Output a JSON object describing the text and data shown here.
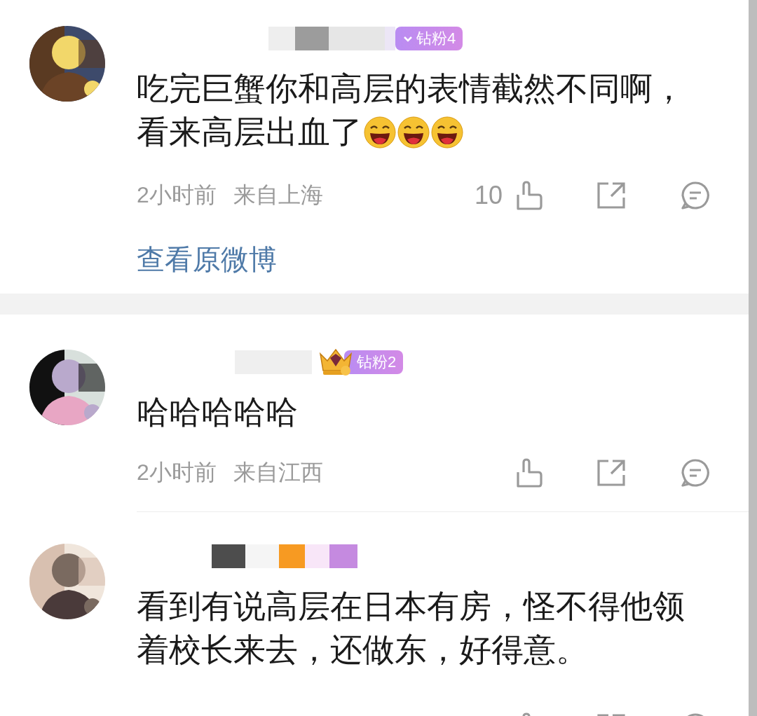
{
  "comments": [
    {
      "badge": {
        "kind": "plain",
        "label": "钻粉4"
      },
      "text": "吃完巨蟹你和高层的表情截然不同啊，看来高层出血了",
      "emojis": [
        {
          "kind": "laughing"
        },
        {
          "kind": "laughing"
        },
        {
          "kind": "laughing"
        }
      ],
      "time": "2小时前",
      "location": "来自上海",
      "likes": "10",
      "link": "查看原微博"
    },
    {
      "badge": {
        "kind": "crown",
        "label": "钻粉2"
      },
      "text": "哈哈哈哈哈",
      "time": "2小时前",
      "location": "来自江西"
    },
    {
      "badge": {
        "kind": "blurred"
      },
      "text": "看到有说高层在日本有房，怪不得他领着校长来去，还做东，好得意。"
    }
  ]
}
